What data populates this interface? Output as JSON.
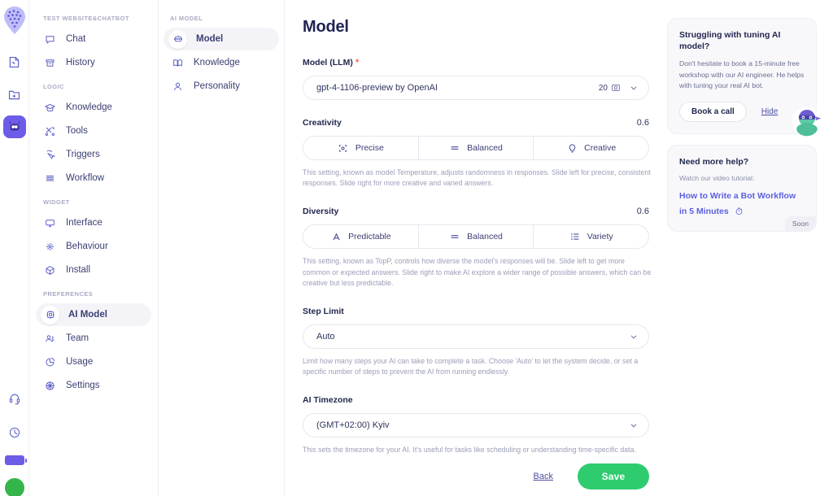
{
  "rail": {
    "logo_name": "app-logo",
    "items": [
      {
        "name": "templates-icon",
        "label": "Templates"
      },
      {
        "name": "new-folder-icon",
        "label": "New folder"
      },
      {
        "name": "bot-avatar-icon",
        "label": "Bot",
        "active": true
      }
    ],
    "bottom": [
      {
        "name": "headset-icon",
        "label": "Support"
      },
      {
        "name": "clock-icon",
        "label": "Activity"
      }
    ],
    "plan_badge": "",
    "user_initials": ""
  },
  "sidebar": {
    "groups": [
      {
        "title": "TEST WEBSITE&CHATBOT",
        "items": [
          {
            "label": "Chat",
            "icon": "chat-bubble-icon"
          },
          {
            "label": "History",
            "icon": "archive-icon"
          }
        ]
      },
      {
        "title": "LOGIC",
        "items": [
          {
            "label": "Knowledge",
            "icon": "graduation-cap-icon"
          },
          {
            "label": "Tools",
            "icon": "tools-icon"
          },
          {
            "label": "Triggers",
            "icon": "cursor-click-icon"
          },
          {
            "label": "Workflow",
            "icon": "layers-icon"
          }
        ]
      },
      {
        "title": "WIDGET",
        "items": [
          {
            "label": "Interface",
            "icon": "monitor-icon"
          },
          {
            "label": "Behaviour",
            "icon": "sparkle-icon"
          },
          {
            "label": "Install",
            "icon": "cube-icon"
          }
        ]
      },
      {
        "title": "PREFERENCES",
        "items": [
          {
            "label": "AI Model",
            "icon": "chip-icon",
            "active": true
          },
          {
            "label": "Team",
            "icon": "users-icon"
          },
          {
            "label": "Usage",
            "icon": "pie-chart-icon"
          },
          {
            "label": "Settings",
            "icon": "gear-icon"
          }
        ]
      }
    ]
  },
  "subnav": {
    "title": "AI MODEL",
    "items": [
      {
        "label": "Model",
        "icon": "robot-icon",
        "active": true
      },
      {
        "label": "Knowledge",
        "icon": "book-icon"
      },
      {
        "label": "Personality",
        "icon": "person-icon"
      }
    ]
  },
  "main": {
    "page_title": "Model",
    "llm": {
      "label": "Model (LLM)",
      "required_mark": "*",
      "value": "gpt-4-1106-preview by OpenAI",
      "credits": "20",
      "credits_icon": "credit-coin-icon",
      "chevron_icon": "chevron-down-icon"
    },
    "creativity": {
      "label": "Creativity",
      "value": "0.6",
      "options": [
        {
          "label": "Precise",
          "icon": "focus-target-icon"
        },
        {
          "label": "Balanced",
          "icon": "equals-icon"
        },
        {
          "label": "Creative",
          "icon": "lightbulb-icon"
        }
      ],
      "hint": "This setting, known as model Temperature, adjusts randomness in responses. Slide left for precise, consistent responses. Slide right for more creative and varied answers."
    },
    "diversity": {
      "label": "Diversity",
      "value": "0.6",
      "options": [
        {
          "label": "Predictable",
          "icon": "letter-a-icon"
        },
        {
          "label": "Balanced",
          "icon": "equals-icon"
        },
        {
          "label": "Variety",
          "icon": "list-icon"
        }
      ],
      "hint": "This setting, known as TopP, controls how diverse the model's responses will be. Slide left to get more common or expected answers. Slide right to make AI explore a wider range of possible answers, which can be creative but less predictable."
    },
    "step_limit": {
      "label": "Step Limit",
      "value": "Auto",
      "hint": "Limit how many steps your AI can take to complete a task. Choose 'Auto' to let the system decide, or set a specific number of steps to prevent the AI from running endlessly."
    },
    "timezone": {
      "label": "AI Timezone",
      "value": "(GMT+02:00) Kyiv",
      "hint": "This sets the timezone for your AI. It's useful for tasks like scheduling or understanding time-specific data."
    },
    "actions": {
      "back_label": "Back",
      "save_label": "Save",
      "save_color": "#2ecc6f"
    }
  },
  "helper": {
    "card_tuning": {
      "title": "Struggling with tuning AI model?",
      "text": "Don't hesitate to book a 15-minute free workshop with our AI engineer. He helps with tuning your real AI bot.",
      "cta_label": "Book a call",
      "hide_label": "Hide"
    },
    "card_help": {
      "title": "Need more help?",
      "subtitle": "Watch our video tutorial:",
      "link_label": "How to Write a Bot Workflow in 5 Minutes",
      "link_icon": "stopwatch-icon",
      "badge": "Soon"
    },
    "avatar_name": "ninja-bot-avatar"
  },
  "colors": {
    "accent_purple": "#6c5ce7",
    "text_dark": "#22274f",
    "muted": "#9b9eb8",
    "save_green": "#2ecc6f",
    "required_orange": "#f06a3c"
  }
}
